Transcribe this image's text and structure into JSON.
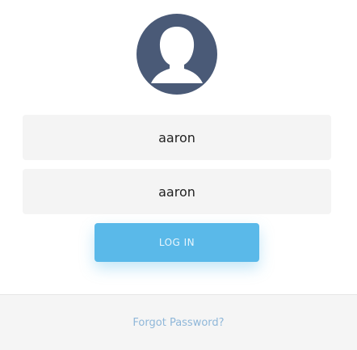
{
  "avatar": {
    "icon": "user-avatar-icon",
    "color": "#4a5a77"
  },
  "login_form": {
    "username_value": "aaron",
    "password_value": "aaron",
    "login_label": "LOG IN",
    "accent_color": "#5ab9e9"
  },
  "footer": {
    "forgot_password_label": "Forgot Password?",
    "link_color": "#8fb7d9"
  }
}
